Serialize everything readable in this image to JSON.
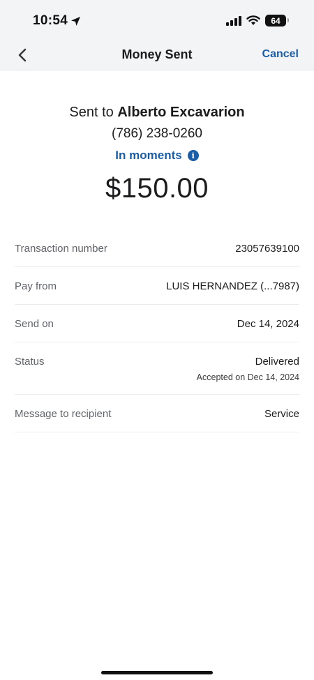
{
  "status_bar": {
    "time": "10:54",
    "battery": "64"
  },
  "nav": {
    "title": "Money Sent",
    "cancel_label": "Cancel"
  },
  "recipient": {
    "prefix": "Sent to ",
    "name": "Alberto Excavarion",
    "phone": "(786) 238-0260",
    "eta": "In moments"
  },
  "amount": "$150.00",
  "details": [
    {
      "label": "Transaction number",
      "value": "23057639100"
    },
    {
      "label": "Pay from",
      "value": "LUIS HERNANDEZ (...7987)"
    },
    {
      "label": "Send on",
      "value": "Dec 14, 2024"
    },
    {
      "label": "Status",
      "value": "Delivered",
      "subvalue": "Accepted on Dec 14, 2024"
    },
    {
      "label": "Message to recipient",
      "value": "Service"
    }
  ],
  "colors": {
    "accent": "#1a5ea8",
    "header_bg": "#f3f4f6"
  }
}
